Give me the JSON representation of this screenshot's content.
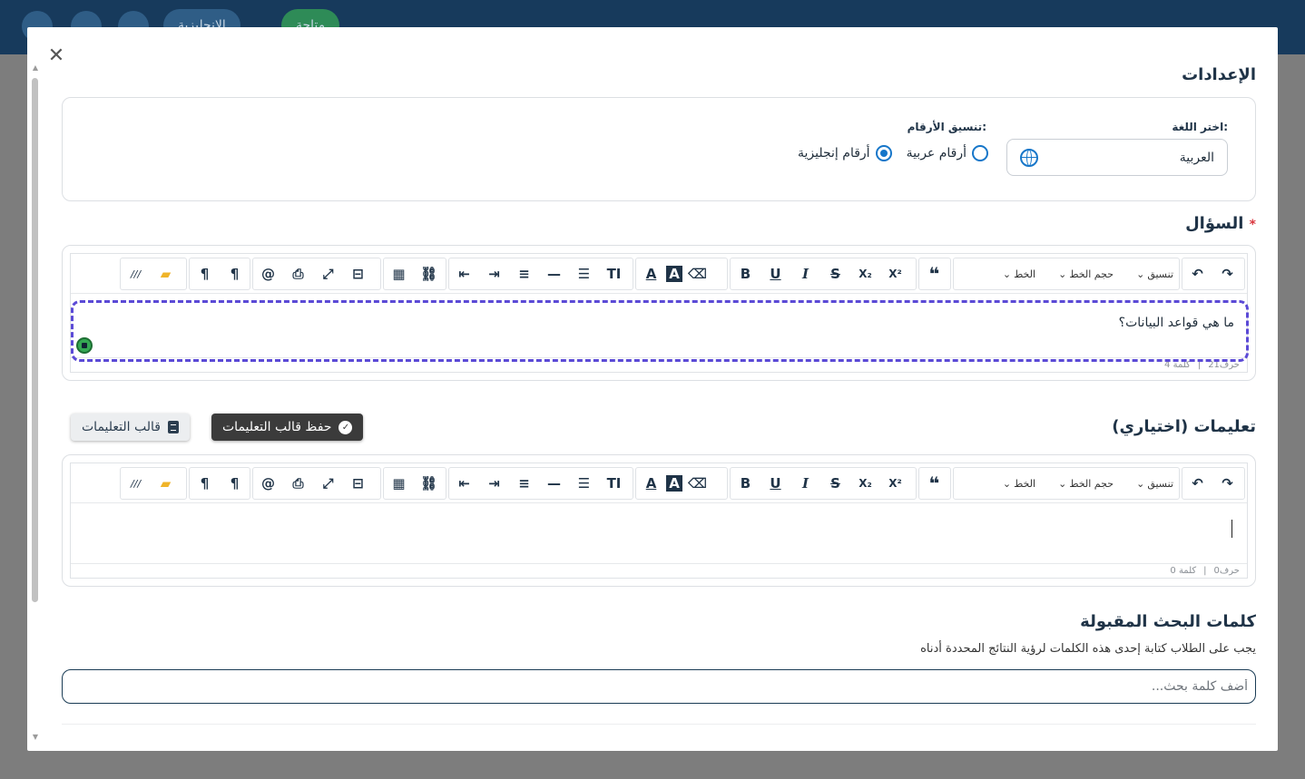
{
  "background": {
    "pill_language": "الإنجليزية",
    "pill_status": "متاحة"
  },
  "modal": {
    "title_settings": "الإعدادات",
    "language_label": "اختر اللغة:",
    "language_value": "العربية",
    "number_format_label": "تنسيق الأرقام:",
    "number_options": [
      "أرقام عربية",
      "أرقام إنجليزية"
    ],
    "number_selected": "أرقام إنجليزية",
    "question_title": "السؤال",
    "required_mark": "*",
    "question_text": "ما هي قواعد البيانات؟",
    "question_chars": "حرف21",
    "question_words": "كلمة 4",
    "instructions_title": "تعليمات (اختياري)",
    "save_template_button": "حفظ قالب التعليمات",
    "template_button": "قالب التعليمات",
    "instructions_chars": "حرف0",
    "instructions_words": "كلمة 0",
    "keywords_title": "كلمات البحث المقبولة",
    "keywords_desc": "يجب على الطلاب كتابة إحدى هذه الكلمات لرؤية النتائج المحددة أدناه",
    "keywords_placeholder": "أضف كلمة بحث...",
    "separator": "|"
  },
  "toolbar": {
    "format_label": "تنسيق",
    "size_label": "حجم الخط",
    "font_label": "الخط",
    "undo": "↶",
    "redo": "↷",
    "quote": "❝",
    "superscript": "X²",
    "subscript": "X₂",
    "strike": "S",
    "italic": "I",
    "underline": "U",
    "bold": "B",
    "eraser": "⌫",
    "bg_color": "A",
    "text_color": "A",
    "text_size": "TI",
    "ordered_list": "☰",
    "hr": "—",
    "align": "≡",
    "indent": "⇥",
    "outdent": "⇤",
    "link": "⛓",
    "table": "▦",
    "blocks": "⊟",
    "fullscreen": "⤢",
    "print": "⎙",
    "mention": "@",
    "ltr": "¶",
    "rtl": "¶",
    "folder": "📁",
    "source": "///"
  }
}
